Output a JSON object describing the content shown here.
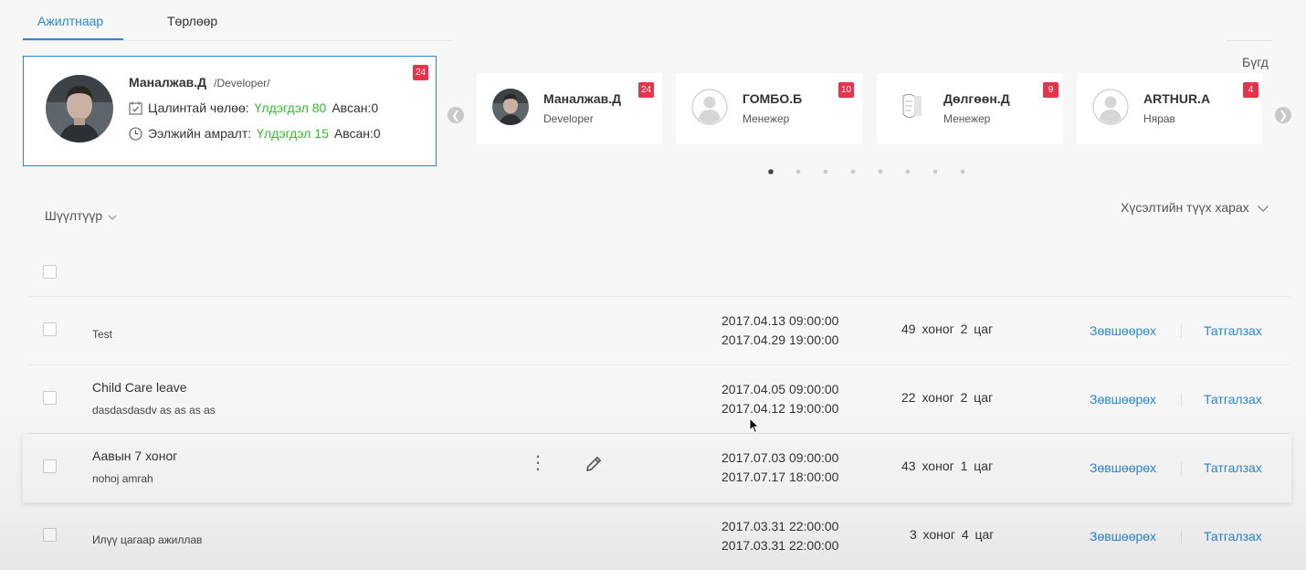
{
  "tabs": [
    {
      "label": "Ажилтнаар",
      "active": true
    },
    {
      "label": "Төрлөөр",
      "active": false
    }
  ],
  "all_label": "Бүгд",
  "selected_employee": {
    "name": "Маналжав.Д",
    "role": "/Developer/",
    "badge": "24",
    "paid_leave_label": "Цалинтай чөлөө:",
    "paid_leave_remaining": "Үлдэгдэл 80",
    "paid_leave_taken": "Авсан:0",
    "vacation_label": "Ээлжийн амралт:",
    "vacation_remaining": "Үлдэгдэл 15",
    "vacation_taken": "Авсан:0"
  },
  "employees": [
    {
      "name": "Маналжав.Д",
      "role": "Developer",
      "badge": "24",
      "avatar": "photo"
    },
    {
      "name": "ГОМБО.Б",
      "role": "Менежер",
      "badge": "10",
      "avatar": "placeholder"
    },
    {
      "name": "Дөлгөөн.Д",
      "role": "Менежер",
      "badge": "9",
      "avatar": "sketch"
    },
    {
      "name": "ARTHUR.A",
      "role": "Нярав",
      "badge": "4",
      "avatar": "placeholder"
    }
  ],
  "carousel": {
    "page_count": 8,
    "active_page": 1
  },
  "filter_label": "Шүүлтүүр",
  "history_label": "Хүсэлтийн түүх харах",
  "requests": [
    {
      "title": "",
      "subtitle": "Test",
      "start": "2017.04.13 09:00:00",
      "end": "2017.04.29 19:00:00",
      "duration": "49 хоног 2 цаг",
      "approve": "Зөвшөөрөх",
      "reject": "Татгалзах"
    },
    {
      "title": "Child Care leave",
      "subtitle": "dasdasdasdv as as as as",
      "start": "2017.04.05 09:00:00",
      "end": "2017.04.12 19:00:00",
      "duration": "22 хоног 2 цаг",
      "approve": "Зөвшөөрөх",
      "reject": "Татгалзах"
    },
    {
      "title": "Аавын 7 хоног",
      "subtitle": "nohoj amrah",
      "start": "2017.07.03 09:00:00",
      "end": "2017.07.17 18:00:00",
      "duration": "43 хоног 1 цаг",
      "approve": "Зөвшөөрөх",
      "reject": "Татгалзах"
    },
    {
      "title": "",
      "subtitle": "Илүү цагаар ажиллав",
      "start": "2017.03.31 22:00:00",
      "end": "2017.03.31 22:00:00",
      "duration": "3 хоног 4 цаг",
      "approve": "Зөвшөөрөх",
      "reject": "Татгалзах"
    }
  ],
  "colors": {
    "accent": "#2a87d6",
    "badge": "#e8334a",
    "remaining": "#2ec22e"
  },
  "icons": {
    "calendar": "calendar-check-icon",
    "clock": "clock-icon",
    "more": "more-vert-icon",
    "edit": "pencil-icon"
  }
}
